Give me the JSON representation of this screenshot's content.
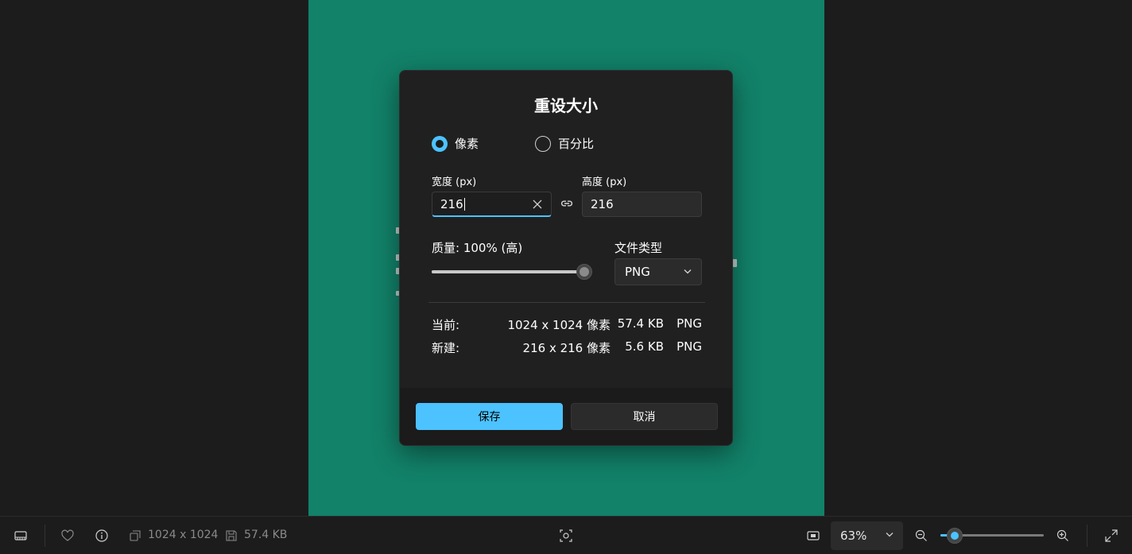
{
  "colors": {
    "accent": "#4cc2ff",
    "preview_background": "#128269",
    "dialog_background": "#202020",
    "app_background": "#1c1c1c"
  },
  "dialog": {
    "title": "重设大小",
    "mode_options": [
      {
        "label": "像素",
        "checked": true
      },
      {
        "label": "百分比",
        "checked": false
      }
    ],
    "width_label": "宽度 (px)",
    "width_value": "216",
    "height_label": "高度 (px)",
    "height_value": "216",
    "quality_label": "质量: 100% (高)",
    "quality_percent": 100,
    "file_type_label": "文件类型",
    "file_type_value": "PNG",
    "current": {
      "label": "当前:",
      "dimensions": "1024 x 1024 像素",
      "size": "57.4 KB",
      "format": "PNG"
    },
    "new": {
      "label": "新建:",
      "dimensions": "216 x 216 像素",
      "size": "5.6 KB",
      "format": "PNG"
    },
    "save_label": "保存",
    "cancel_label": "取消"
  },
  "bottombar": {
    "filmstrip_icon": "filmstrip-icon",
    "favorite_icon": "heart-icon",
    "info_icon": "info-icon",
    "dimensions": "1024 x 1024",
    "file_size": "57.4 KB",
    "zoom_value": "63%",
    "zoom_percent": 63
  }
}
